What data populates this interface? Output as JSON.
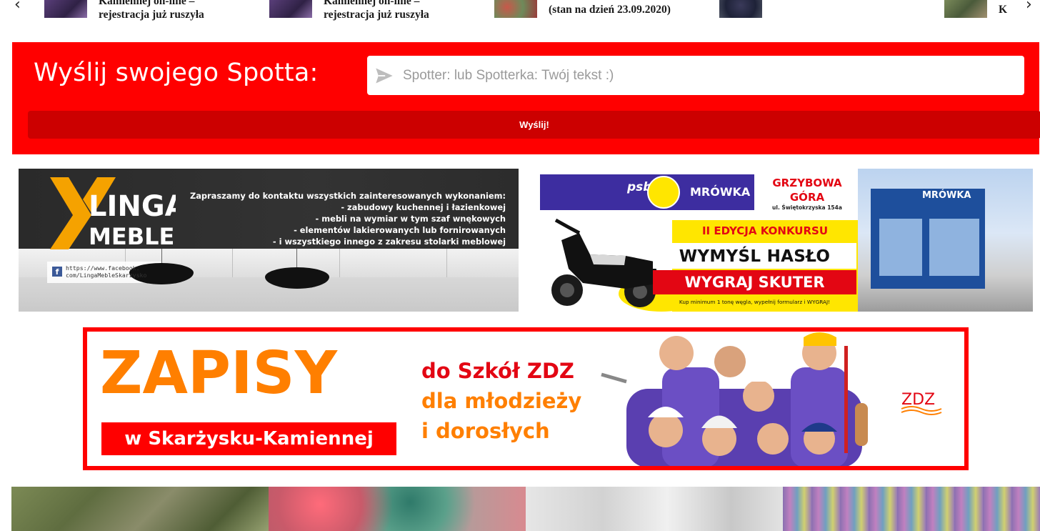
{
  "carousel": {
    "prev_icon": "chevron-left-icon",
    "next_icon": "chevron-right-icon",
    "items": [
      {
        "line1": "Kamiennej on-line –",
        "line2": "rejestracja już ruszyła",
        "thumb_color": "#4a3a6a"
      },
      {
        "line1": "Kamiennej on-line –",
        "line2": "rejestracja już ruszyła",
        "thumb_color": "#4a3a6a"
      },
      {
        "line1": "(stan na dzień 23.09.2020)",
        "line2": "",
        "thumb_color": "#8a4a3a"
      },
      {
        "line1": "",
        "line2": "",
        "thumb_color": "#2a3050"
      },
      {
        "line1": "K",
        "line2": "",
        "thumb_color": "#5b6a4a"
      }
    ]
  },
  "spot": {
    "title": "Wyślij swojego Spotta:",
    "placeholder": "Spotter: lub Spotterka: Twój tekst :)",
    "value": "",
    "submit_label": "Wyślij!",
    "send_icon": "send-icon",
    "colors": {
      "box": "#ff0000",
      "button": "#cc0000"
    }
  },
  "banners": {
    "linga": {
      "logo_top": "LINGA",
      "logo_bottom": "MEBLE",
      "intro": "Zapraszamy do kontaktu wszystkich zainteresowanych wykonaniem:",
      "services": [
        "- zabudowy kuchennej i łazienkowej",
        "- mebli na wymiar w tym szaf wnękowych",
        "- elementów lakierowanych lub fornirowanych",
        "- i wszystkiego innego z zakresu stolarki meblowej"
      ],
      "fb_line1": "https://www.facebook.",
      "fb_line2": "com/LingaMebleSkarzysko",
      "fb_icon": "facebook-icon"
    },
    "mrowka": {
      "psb": "psb",
      "brand": "MRÓWKA",
      "location_l1": "GRZYBOWA",
      "location_l2": "GÓRA",
      "address": "ul. Świętokrzyska 154a",
      "edition": "II EDYCJA KONKURSU",
      "slogan1": "WYMYŚL HASŁO",
      "slogan2": "WYGRAJ SKUTER",
      "fine_print": "Kup minimum 1 tonę węgla, wypełnij formularz i WYGRAJ!",
      "building_sign": "MRÓWKA"
    },
    "zdz": {
      "headline": "ZAPISY",
      "city": "w Skarżysku-Kamiennej",
      "line1": "do Szkół ZDZ",
      "line2": "dla młodzieży",
      "line3": "i dorosłych",
      "logo": "ZDZ"
    }
  },
  "photos": [
    {
      "name": "photo-forest",
      "color": "#6b7a4a"
    },
    {
      "name": "photo-virus",
      "color": "#8a9e96"
    },
    {
      "name": "photo-interior",
      "color": "#d8d8d8"
    },
    {
      "name": "photo-store",
      "color": "#8a7aa8"
    }
  ]
}
